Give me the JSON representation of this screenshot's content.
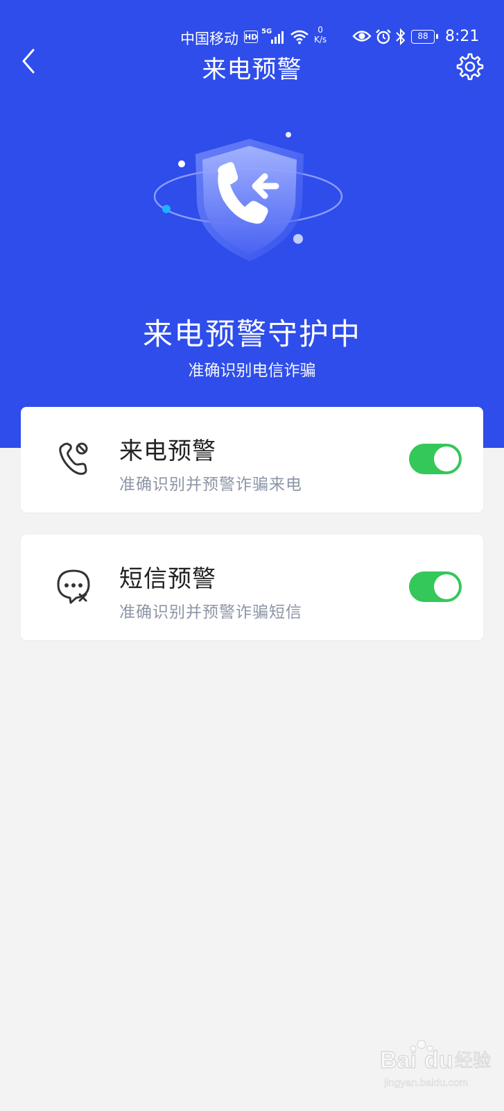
{
  "status_bar": {
    "carrier": "中国移动",
    "hd": "HD",
    "network": "5G",
    "speed_value": "0",
    "speed_unit": "K/s",
    "battery": "88",
    "time": "8:21"
  },
  "header": {
    "title": "来电预警"
  },
  "hero": {
    "title": "来电预警守护中",
    "subtitle": "准确识别电信诈骗"
  },
  "cards": [
    {
      "name": "来电预警",
      "desc": "准确识别并预警诈骗来电",
      "enabled": true,
      "icon": "phone-block-icon"
    },
    {
      "name": "短信预警",
      "desc": "准确识别并预警诈骗短信",
      "enabled": true,
      "icon": "message-block-icon"
    }
  ],
  "watermark": {
    "brand": "Baidu经验",
    "url": "jingyan.baidu.com"
  },
  "colors": {
    "primary": "#2e4deb",
    "toggle_on": "#34c759",
    "background": "#f3f3f3"
  }
}
